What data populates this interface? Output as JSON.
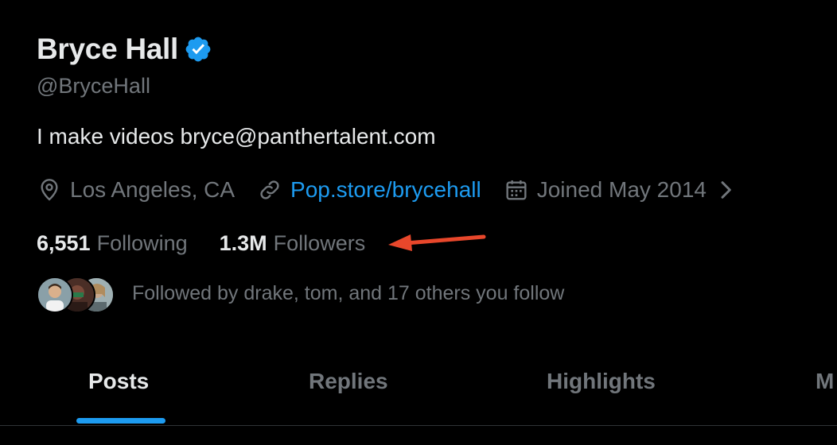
{
  "profile": {
    "name": "Bryce Hall",
    "handle": "@BryceHall",
    "bio": "I make videos bryce@panthertalent.com",
    "location": "Los Angeles, CA",
    "website": "Pop.store/brycehall",
    "joined": "Joined May 2014",
    "following_count": "6,551",
    "following_label": "Following",
    "followers_count": "1.3M",
    "followers_label": "Followers",
    "followed_by": "Followed by drake, tom, and 17 others you follow"
  },
  "tabs": [
    {
      "label": "Posts",
      "active": true
    },
    {
      "label": "Replies",
      "active": false
    },
    {
      "label": "Highlights",
      "active": false
    },
    {
      "label": "M",
      "active": false
    }
  ],
  "icons": {
    "verified": "verified-badge-icon",
    "location": "location-pin-icon",
    "link": "link-icon",
    "calendar": "calendar-icon",
    "chevron": "chevron-right-icon",
    "annotation": "red-arrow-annotation"
  },
  "colors": {
    "background": "#000000",
    "primary_text": "#e7e9ea",
    "secondary_text": "#71767b",
    "accent": "#1d9bf0",
    "annotation": "#e8472b"
  }
}
